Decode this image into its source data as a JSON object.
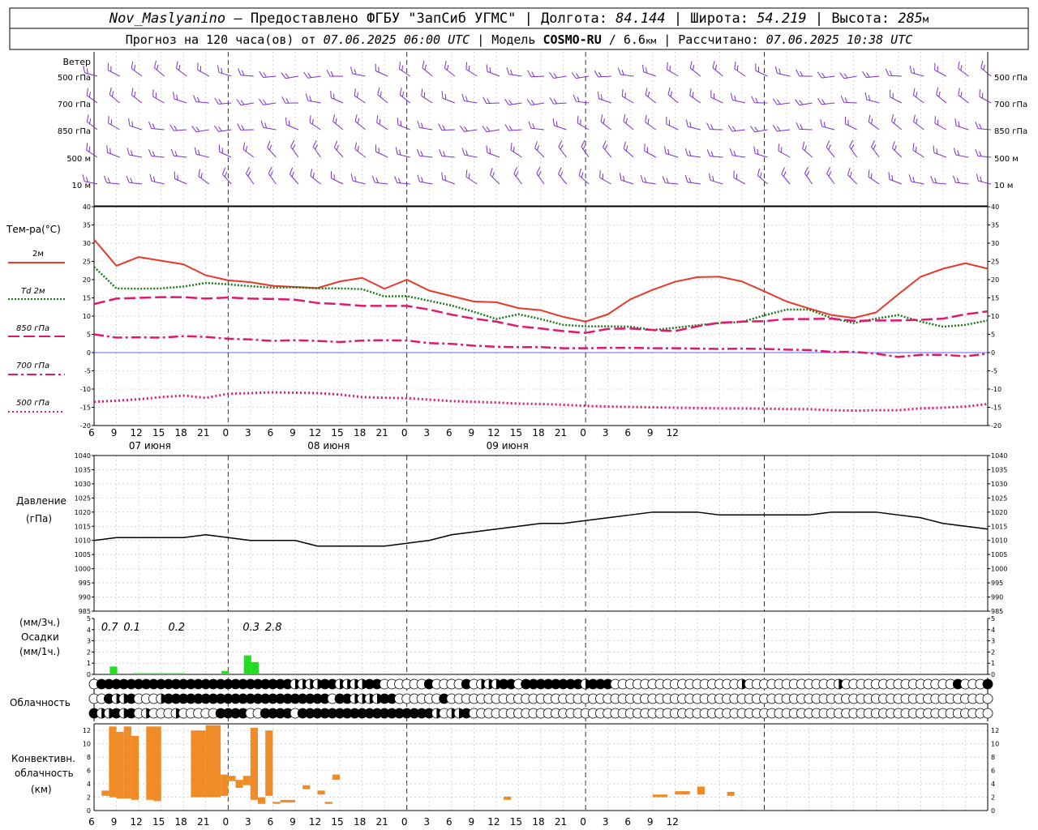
{
  "header": {
    "station": "Nov_Maslyanino",
    "provider": " — Предоставлено ФГБУ \"ЗапСиб УГМС\" | Долгота: ",
    "lon": "84.144",
    "lat_label": " | Широта: ",
    "lat": "54.219",
    "alt_label": " | Высота: ",
    "alt": "285",
    "alt_unit": "м",
    "line2_a": "Прогноз на 120 часа(ов) от ",
    "run": "07.06.2025 06:00 UTC",
    "line2_b": " | Модель ",
    "model": "COSMO-RU",
    "model_res": " / 6.6",
    "res_unit": "км",
    "line2_c": " | Рассчитано: ",
    "calc": "07.06.2025 10:38 UTC"
  },
  "panels": {
    "wind": {
      "title": "Ветер",
      "levels": [
        "500 гПа",
        "700 гПа",
        "850 гПа",
        "500 м",
        "10 м"
      ]
    },
    "temp": {
      "title": "Тем-ра(°C)",
      "legend": [
        {
          "label": "2м",
          "color": "#e8382a"
        },
        {
          "label": "Td 2м",
          "color": "#1a7a1a"
        },
        {
          "label": "850 гПа",
          "color": "#e0186e"
        },
        {
          "label": "700 гПа",
          "color": "#e0186e"
        },
        {
          "label": "500 гПа",
          "color": "#e0186e"
        }
      ],
      "yticks": [
        "40",
        "35",
        "30",
        "25",
        "20",
        "15",
        "10",
        "5",
        "0",
        "-5",
        "-10",
        "-15",
        "-20"
      ]
    },
    "pressure": {
      "title1": "Давление",
      "title2": "(гПа)",
      "yticks": [
        "1040",
        "1035",
        "1030",
        "1025",
        "1020",
        "1015",
        "1010",
        "1005",
        "1000",
        "995",
        "990",
        "985"
      ]
    },
    "precip": {
      "title1": "(мм/3ч.)",
      "title2": "Осадки",
      "title3": "(мм/1ч.)",
      "yticks": [
        "5",
        "4",
        "3",
        "2",
        "1",
        "0"
      ],
      "labels": [
        "0.7",
        "0.1",
        "0.2",
        "0.3",
        "2.8"
      ]
    },
    "clouds": {
      "title": "Облачность"
    },
    "conv": {
      "title1": "Конвективн.",
      "title2": "облачность",
      "title3": "(км)",
      "yticks": [
        "12",
        "10",
        "8",
        "6",
        "4",
        "2",
        "0"
      ]
    }
  },
  "xaxis": {
    "hour_labels": [
      "6",
      "9",
      "12",
      "15",
      "18",
      "21",
      "0",
      "3",
      "6",
      "9",
      "12",
      "15",
      "18",
      "21",
      "0",
      "3",
      "6",
      "9",
      "12",
      "15",
      "18",
      "21",
      "0",
      "3",
      "6",
      "9",
      "12"
    ],
    "day_labels": [
      "07 июня",
      "08 июня",
      "09 июня"
    ]
  },
  "colors": {
    "t2m": "#e8382a",
    "td2m": "#1a7a1a",
    "isobaric": "#e0186e",
    "wind": "#7b2fd0",
    "precip": "#22dd22",
    "conv": "#f08c28",
    "zero_line": "#3030ff"
  },
  "chart_data": [
    {
      "type": "line",
      "title": "Тем-ра(°C)",
      "x_hours_from_run": [
        0,
        3,
        6,
        9,
        12,
        15,
        18,
        21,
        24,
        27,
        30,
        33,
        36,
        39,
        42,
        45,
        48,
        51,
        54,
        57,
        60,
        63,
        66,
        69,
        72,
        75,
        78,
        81,
        84,
        87,
        90,
        93,
        96,
        99,
        102,
        105,
        108,
        111,
        114,
        117,
        120
      ],
      "ylim": [
        -20,
        40
      ],
      "series": [
        {
          "name": "2м",
          "values": [
            31,
            23.8,
            26.2,
            25.2,
            24.2,
            21.2,
            19.8,
            19.3,
            18.3,
            18,
            17.7,
            19.5,
            20.5,
            17.5,
            20,
            17,
            15.5,
            14,
            13.8,
            12.2,
            11.6,
            9.8,
            8.5,
            10.5,
            14.6,
            17.2,
            19.4,
            20.7,
            20.8,
            19.5,
            16.8,
            14,
            12.1,
            10.3,
            9.5,
            11,
            16,
            20.8,
            23,
            24.5,
            23
          ]
        },
        {
          "name": "Td 2м",
          "values": [
            23.5,
            17.6,
            17.5,
            17.6,
            18.1,
            19.1,
            18.7,
            18.2,
            17.8,
            17.9,
            17.6,
            17.6,
            17.4,
            15.4,
            15.5,
            14.2,
            12.9,
            11.2,
            9.2,
            10.5,
            9.2,
            7.6,
            7.2,
            7.2,
            7.1,
            6.2,
            6.8,
            7.5,
            8.1,
            8.4,
            10.2,
            11.8,
            11.8,
            9.5,
            8.1,
            9.3,
            10.3,
            8.5,
            7.1,
            7.6,
            8.8
          ]
        },
        {
          "name": "850 гПа",
          "values": [
            13.3,
            14.8,
            15,
            15.2,
            15.2,
            14.8,
            15.1,
            14.8,
            14.7,
            14.5,
            13.6,
            13.3,
            12.8,
            12.8,
            12.8,
            11.8,
            10.4,
            9.3,
            8.5,
            7.2,
            6.6,
            5.9,
            5.4,
            6.5,
            6.6,
            6.2,
            5.9,
            7.2,
            8.2,
            8.5,
            8.6,
            9.2,
            9.2,
            9.3,
            8.7,
            8.8,
            8.8,
            9,
            9.3,
            10.5,
            11.3
          ]
        },
        {
          "name": "700 гПа",
          "values": [
            5,
            4.1,
            4.2,
            4.1,
            4.5,
            4.3,
            3.8,
            3.6,
            3.2,
            3.4,
            3.2,
            2.9,
            3.3,
            3.4,
            3.3,
            2.6,
            2.4,
            1.9,
            1.6,
            1.5,
            1.5,
            1.2,
            1.2,
            1.3,
            1.3,
            1.2,
            1.2,
            1.1,
            1,
            1.1,
            1,
            0.8,
            0.7,
            0.2,
            0.2,
            -0.3,
            -1.2,
            -0.6,
            -0.6,
            -1,
            -0.3
          ]
        },
        {
          "name": "500 гПа",
          "values": [
            -13.5,
            -13.2,
            -12.8,
            -12.2,
            -11.8,
            -12.4,
            -11.3,
            -11.1,
            -10.9,
            -11,
            -11.1,
            -11.5,
            -12.2,
            -12.4,
            -12.5,
            -12.9,
            -13.3,
            -13.5,
            -13.7,
            -14,
            -14.1,
            -14.3,
            -14.6,
            -14.8,
            -14.9,
            -15,
            -15.1,
            -15.2,
            -15.3,
            -15.3,
            -15.4,
            -15.5,
            -15.5,
            -15.8,
            -15.9,
            -15.8,
            -15.8,
            -15.3,
            -15.1,
            -14.8,
            -14.1
          ]
        }
      ]
    },
    {
      "type": "line",
      "title": "Давление",
      "ylabel": "(гПа)",
      "x_hours_from_run": [
        0,
        3,
        6,
        9,
        12,
        15,
        18,
        21,
        24,
        27,
        30,
        33,
        36,
        39,
        42,
        45,
        48,
        51,
        54,
        57,
        60,
        63,
        66,
        69,
        72,
        75,
        78,
        81,
        84,
        87,
        90,
        93,
        96,
        99,
        102,
        105,
        108,
        111,
        114,
        117,
        120
      ],
      "ylim": [
        985,
        1040
      ],
      "series": [
        {
          "name": "Давление",
          "values": [
            1010,
            1011,
            1011,
            1011,
            1011,
            1012,
            1011,
            1010,
            1010,
            1010,
            1008,
            1008,
            1008,
            1008,
            1009,
            1010,
            1012,
            1013,
            1014,
            1015,
            1016,
            1016,
            1017,
            1018,
            1019,
            1020,
            1020,
            1020,
            1019,
            1019,
            1019,
            1019,
            1019,
            1020,
            1020,
            1020,
            1019,
            1018,
            1016,
            1015,
            1014
          ]
        }
      ]
    },
    {
      "type": "bar",
      "title": "Осадки",
      "ylabel": "(мм/1ч.)",
      "ylim": [
        0,
        5
      ],
      "x_hours_from_run": [
        2,
        5,
        6,
        7,
        8,
        9,
        10,
        11,
        17,
        20,
        21
      ],
      "values": [
        0.7,
        0.1,
        0.1,
        0.1,
        0.1,
        0.1,
        0.1,
        0.1,
        0.3,
        1.7,
        1.1
      ],
      "sum3h_hours": [
        1,
        4,
        10,
        20,
        23
      ],
      "sum3h_labels": [
        "0.7",
        "0.1",
        "0.2",
        "0.3",
        "2.8"
      ]
    },
    {
      "type": "table",
      "title": "Облачность",
      "rows": [
        {
          "values": "011111111111111111111111111222211222211000000100001022211011111111211100000000000000000200000000000020000000000000001000112100000000001"
        },
        {
          "values": "001221000211111111111111111111110112222110000001000000000000000000000000000000000000000000000000000000000000000000000000000002110000000000"
        },
        {
          "values": "122121020002000001111001111011111111111111111120221000000000000000000000000000000000000000000000000000000000000000000000000000000000000000"
        }
      ]
    },
    {
      "type": "bar",
      "title": "Конвективн. облачность",
      "ylabel": "(км)",
      "ylim": [
        0,
        13
      ],
      "bars": [
        {
          "start": 0,
          "end": 1,
          "bottom": 2.2,
          "top": 3.0
        },
        {
          "start": 1,
          "end": 2,
          "bottom": 2,
          "top": 12.6
        },
        {
          "start": 2,
          "end": 3,
          "bottom": 1.8,
          "top": 11.8
        },
        {
          "start": 3,
          "end": 4,
          "bottom": 1.8,
          "top": 12.6
        },
        {
          "start": 4,
          "end": 5,
          "bottom": 1.6,
          "top": 11.2
        },
        {
          "start": 6,
          "end": 7,
          "bottom": 1.6,
          "top": 12.6
        },
        {
          "start": 7,
          "end": 8,
          "bottom": 1.4,
          "top": 12.6
        },
        {
          "start": 12,
          "end": 14,
          "bottom": 2.0,
          "top": 12.0
        },
        {
          "start": 14,
          "end": 16,
          "bottom": 2.0,
          "top": 12.8
        },
        {
          "start": 16,
          "end": 17,
          "bottom": 2.2,
          "top": 5.4
        },
        {
          "start": 17,
          "end": 18,
          "bottom": 4.4,
          "top": 5.2
        },
        {
          "start": 18,
          "end": 19,
          "bottom": 3.4,
          "top": 4.6
        },
        {
          "start": 19,
          "end": 20,
          "bottom": 3.8,
          "top": 5.2
        },
        {
          "start": 20,
          "end": 21,
          "bottom": 1.6,
          "top": 12.4
        },
        {
          "start": 21,
          "end": 22,
          "bottom": 1.0,
          "top": 2.0
        },
        {
          "start": 22,
          "end": 23,
          "bottom": 2.2,
          "top": 12.0
        },
        {
          "start": 23,
          "end": 24,
          "bottom": 1.0,
          "top": 1.3
        },
        {
          "start": 24,
          "end": 26,
          "bottom": 1.2,
          "top": 1.6
        },
        {
          "start": 27,
          "end": 28,
          "bottom": 3.2,
          "top": 3.8
        },
        {
          "start": 29,
          "end": 30,
          "bottom": 2.4,
          "top": 3.0
        },
        {
          "start": 30,
          "end": 31,
          "bottom": 1.0,
          "top": 1.3
        },
        {
          "start": 31,
          "end": 32,
          "bottom": 4.6,
          "top": 5.4
        },
        {
          "start": 54,
          "end": 55,
          "bottom": 1.6,
          "top": 2.1
        },
        {
          "start": 74,
          "end": 76,
          "bottom": 2.0,
          "top": 2.4
        },
        {
          "start": 77,
          "end": 79,
          "bottom": 2.4,
          "top": 2.9
        },
        {
          "start": 80,
          "end": 81,
          "bottom": 2.4,
          "top": 3.6
        },
        {
          "start": 84,
          "end": 85,
          "bottom": 2.2,
          "top": 2.8
        }
      ]
    }
  ]
}
